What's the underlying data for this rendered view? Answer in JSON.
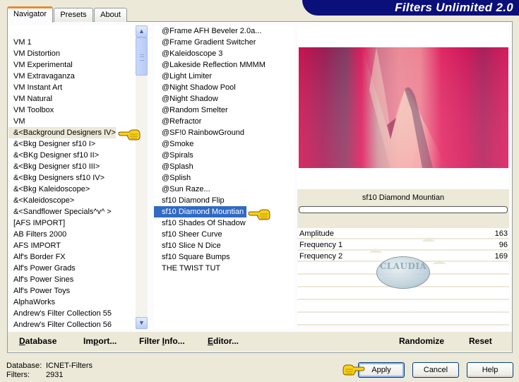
{
  "app": {
    "title": "Filters Unlimited 2.0"
  },
  "tabs": [
    {
      "label": "Navigator",
      "active": true
    },
    {
      "label": "Presets",
      "active": false
    },
    {
      "label": "About",
      "active": false
    }
  ],
  "categories": {
    "hovered_index": 8,
    "items": [
      "VM 1",
      "VM Distortion",
      "VM Experimental",
      "VM Extravaganza",
      "VM Instant Art",
      "VM Natural",
      "VM Toolbox",
      "VM",
      "&<Background Designers IV>",
      "&<Bkg Designer sf10 I>",
      "&<BKg Designer sf10 II>",
      "&<Bkg Designer sf10 III>",
      "&<Bkg Designers sf10 IV>",
      "&<Bkg Kaleidoscope>",
      "&<Kaleidoscope>",
      "&<Sandflower Specials^v^ >",
      "[AFS IMPORT]",
      "AB Filters 2000",
      "AFS IMPORT",
      "Alf's Border FX",
      "Alf's Power Grads",
      "Alf's Power Sines",
      "Alf's Power Toys",
      "AlphaWorks",
      "Andrew's Filter Collection 55",
      "Andrew's Filter Collection 56"
    ]
  },
  "filters": {
    "selected_index": 17,
    "items": [
      "@Frame AFH Beveler 2.0a...",
      "@Frame Gradient Switcher",
      "@Kaleidoscope 3",
      "@Lakeside Reflection MMMM",
      "@Light Limiter",
      "@Night Shadow Pool",
      "@Night Shadow",
      "@Random Smelter",
      "@Refractor",
      "@SF!0 RainbowGround",
      "@Smoke",
      "@Spirals",
      "@Splash",
      "@Splish",
      "@Sun Raze...",
      "sf10 Diamond Flip",
      "sf10 Diamond Mountian",
      "sf10 Shades Of Shadow",
      "sf10 Sheer Curve",
      "sf10 Slice N Dice",
      "sf10 Square Bumps",
      "THE TWIST TUT"
    ]
  },
  "preview": {
    "filter_name": "sf10 Diamond Mountian",
    "progress": 0,
    "colors": {
      "crimson": "#d81b5c",
      "plum": "#8a1f52",
      "blush": "#f3c2b8",
      "mauve": "#7a5a72"
    }
  },
  "parameters": [
    {
      "label": "Amplitude",
      "value": "163"
    },
    {
      "label": "Frequency 1",
      "value": "96"
    },
    {
      "label": "Frequency 2",
      "value": "169"
    }
  ],
  "watermark": {
    "text": "CLAUDIA"
  },
  "panel_buttons": {
    "randomize": "Randomize",
    "reset": "Reset"
  },
  "toolbar": {
    "database": {
      "pre": "",
      "key": "D",
      "post": "atabase"
    },
    "import": {
      "pre": "Im",
      "key": "p",
      "post": "ort..."
    },
    "filter_info": {
      "pre": "Filter ",
      "key": "I",
      "post": "nfo..."
    },
    "editor": {
      "pre": "",
      "key": "E",
      "post": "ditor..."
    }
  },
  "status": {
    "database_label": "Database:",
    "database_value": "ICNET-Filters",
    "filters_label": "Filters:",
    "filters_value": "2931"
  },
  "dialog_buttons": {
    "apply": "Apply",
    "cancel": "Cancel",
    "help": "Help"
  }
}
